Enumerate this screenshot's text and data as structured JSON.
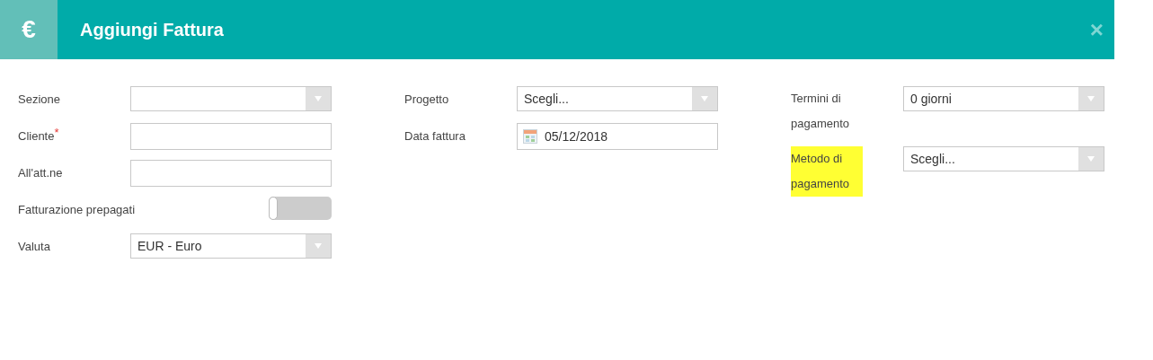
{
  "dialog": {
    "icon": "€",
    "title": "Aggiungi Fattura",
    "close": "×"
  },
  "columns": [
    {
      "fields": [
        {
          "kind": "select",
          "label": "Sezione",
          "highlighted": false
        },
        {
          "kind": "text",
          "label": "Cliente",
          "required_mark": "*",
          "highlighted": false
        },
        {
          "kind": "text",
          "label": "All'att.ne",
          "highlighted": false
        },
        {
          "kind": "toggle",
          "label": "Fatturazione prepagati",
          "highlighted": false,
          "on": false
        },
        {
          "kind": "select",
          "label": "Valuta",
          "value": "EUR - Euro",
          "highlighted": false
        }
      ]
    },
    {
      "fields": [
        {
          "kind": "select",
          "label": "Progetto",
          "value": "Scegli...",
          "highlighted": false
        },
        {
          "kind": "date",
          "label": "Data fattura",
          "value": "05/12/2018",
          "highlighted": false
        }
      ]
    },
    {
      "fields": [
        {
          "kind": "select",
          "label": "Termini di pagamento",
          "value": "0 giorni",
          "highlighted": false
        },
        {
          "kind": "select",
          "label": "Metodo di pagamento",
          "value": "Scegli...",
          "highlighted": true
        }
      ]
    }
  ]
}
